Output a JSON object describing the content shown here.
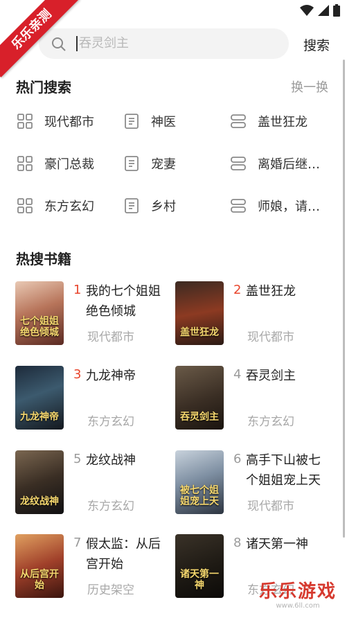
{
  "status_bar": {
    "icons": [
      "wifi-icon",
      "signal-icon",
      "battery-icon"
    ]
  },
  "ribbon": {
    "text": "乐乐亲测",
    "color": "#d8202a"
  },
  "search": {
    "placeholder": "吞灵剑主",
    "button_label": "搜索"
  },
  "hot_search": {
    "title": "热门搜索",
    "refresh_label": "换一换",
    "items": [
      {
        "label": "现代都市",
        "icon": "grid-icon"
      },
      {
        "label": "神医",
        "icon": "book-icon"
      },
      {
        "label": "盖世狂龙",
        "icon": "stack-icon"
      },
      {
        "label": "豪门总裁",
        "icon": "grid-icon"
      },
      {
        "label": "宠妻",
        "icon": "book-icon"
      },
      {
        "label": "离婚后继…",
        "icon": "stack-icon"
      },
      {
        "label": "东方玄幻",
        "icon": "grid-icon"
      },
      {
        "label": "乡村",
        "icon": "book-icon"
      },
      {
        "label": "师娘，请…",
        "icon": "stack-icon"
      }
    ]
  },
  "hot_books": {
    "title": "热搜书籍",
    "top_rank_color": "#e8452c",
    "items": [
      {
        "rank": "1",
        "title": "我的七个姐姐绝色倾城",
        "category": "现代都市",
        "cover_text": "七个姐姐绝色倾城"
      },
      {
        "rank": "2",
        "title": "盖世狂龙",
        "category": "现代都市",
        "cover_text": "盖世狂龙"
      },
      {
        "rank": "3",
        "title": "九龙神帝",
        "category": "东方玄幻",
        "cover_text": "九龙神帝"
      },
      {
        "rank": "4",
        "title": "吞灵剑主",
        "category": "东方玄幻",
        "cover_text": "吞灵剑主"
      },
      {
        "rank": "5",
        "title": "龙纹战神",
        "category": "东方玄幻",
        "cover_text": "龙纹战神"
      },
      {
        "rank": "6",
        "title": "高手下山被七个姐姐宠上天",
        "category": "现代都市",
        "cover_text": "被七个姐姐宠上天"
      },
      {
        "rank": "7",
        "title": "假太监：从后宫开始",
        "category": "历史架空",
        "cover_text": "从后宫开始"
      },
      {
        "rank": "8",
        "title": "诸天第一神",
        "category": "东方玄幻",
        "cover_text": "诸天第一神"
      }
    ]
  },
  "watermark": {
    "line1": "乐乐游戏",
    "line2": "www.6ll.com"
  }
}
